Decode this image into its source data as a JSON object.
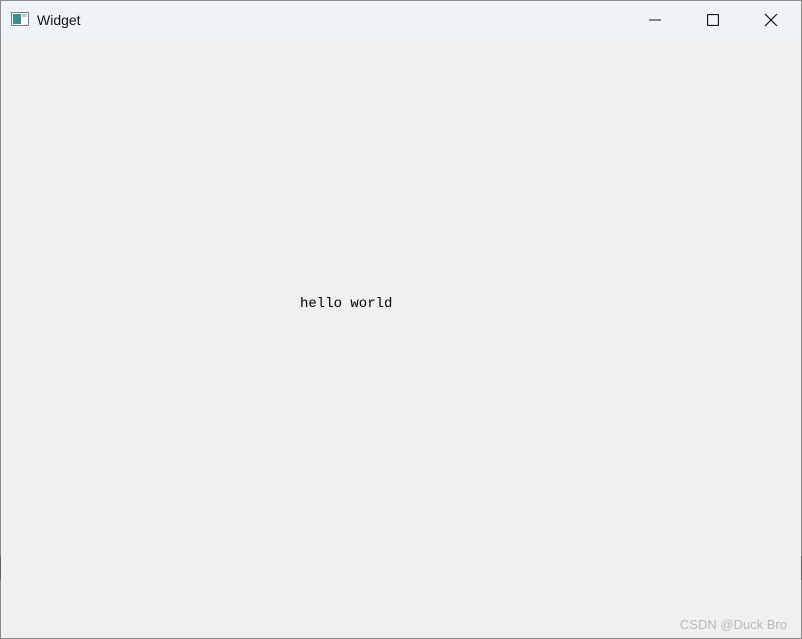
{
  "window": {
    "title": "Widget",
    "icon": "qt-widget-window-icon",
    "controls": {
      "minimize_icon": "minimize-icon",
      "maximize_icon": "maximize-icon",
      "close_icon": "close-icon"
    }
  },
  "content": {
    "label_text": "hello world"
  },
  "watermark": {
    "text": "CSDN @Duck Bro"
  },
  "colors": {
    "titlebar_bg": "#eef3f8",
    "client_bg": "#f0f0f0",
    "text": "#000000",
    "watermark": "#b8b8b8"
  }
}
